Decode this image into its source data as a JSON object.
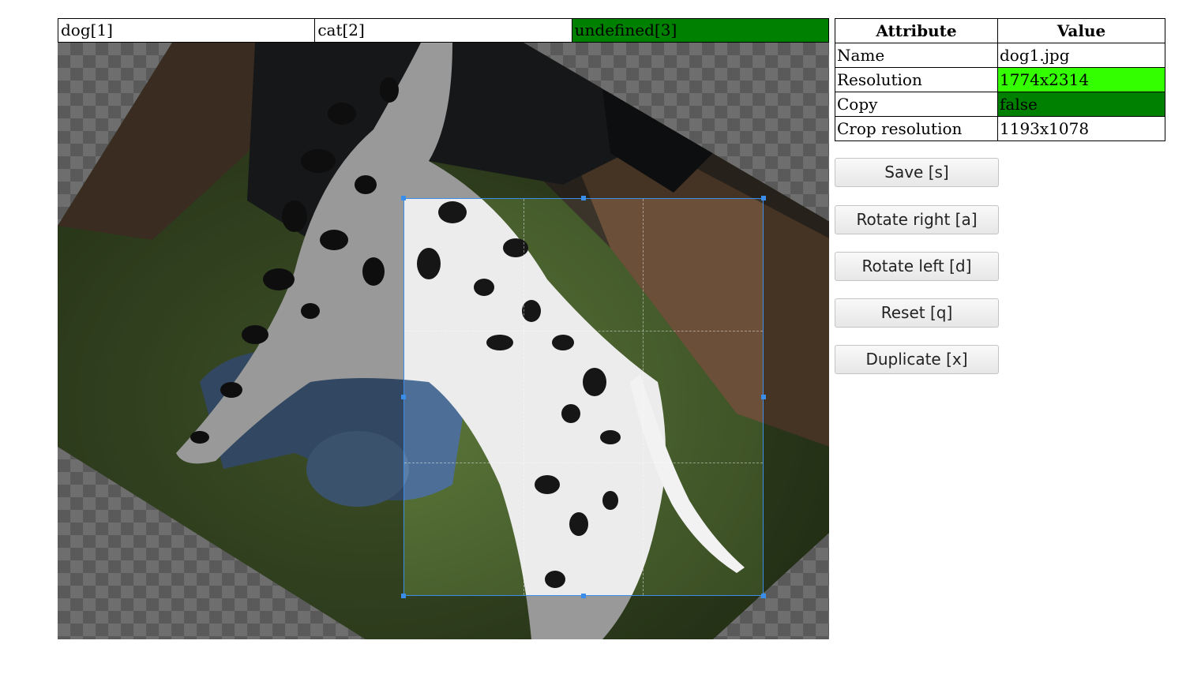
{
  "label_tabs": [
    {
      "label": "dog[1]",
      "active": false
    },
    {
      "label": "cat[2]",
      "active": false
    },
    {
      "label": "undefined[3]",
      "active": true
    }
  ],
  "image_alt": "",
  "attributes": {
    "headers": [
      "Attribute",
      "Value"
    ],
    "rows": [
      {
        "key": "Name",
        "value": "dog1.jpg"
      },
      {
        "key": "Resolution",
        "value": "1774x2314"
      },
      {
        "key": "Copy",
        "value": "false"
      },
      {
        "key": "Crop resolution",
        "value": "1193x1078"
      }
    ]
  },
  "buttons": {
    "save": "Save [s]",
    "rotate_right": "Rotate right [a]",
    "rotate_left": "Rotate left [d]",
    "reset": "Reset [q]",
    "duplicate": "Duplicate [x]"
  },
  "colors": {
    "active_tab": "#008000",
    "highlight_bright": "#33ff00",
    "highlight_dark": "#008000",
    "crop_border": "#3a8eea"
  }
}
